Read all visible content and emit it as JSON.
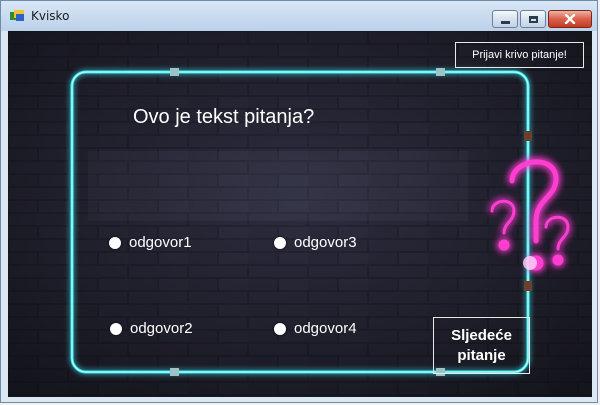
{
  "window": {
    "title": "Kvisko"
  },
  "report_button": {
    "label": "Prijavi krivo pitanje!"
  },
  "question": {
    "text": "Ovo je tekst pitanja?"
  },
  "answers": [
    {
      "label": "odgovor1"
    },
    {
      "label": "odgovor2"
    },
    {
      "label": "odgovor3"
    },
    {
      "label": "odgovor4"
    }
  ],
  "next_button": {
    "label": "Sljedeće pitanje"
  },
  "colors": {
    "neon_frame": "#39e6ee",
    "neon_question_mark": "#ff3dd2",
    "brick": "#2a2c38"
  },
  "icons": {
    "app": "kvisko-app-icon",
    "background_mark": "neon-question-mark-icon"
  }
}
